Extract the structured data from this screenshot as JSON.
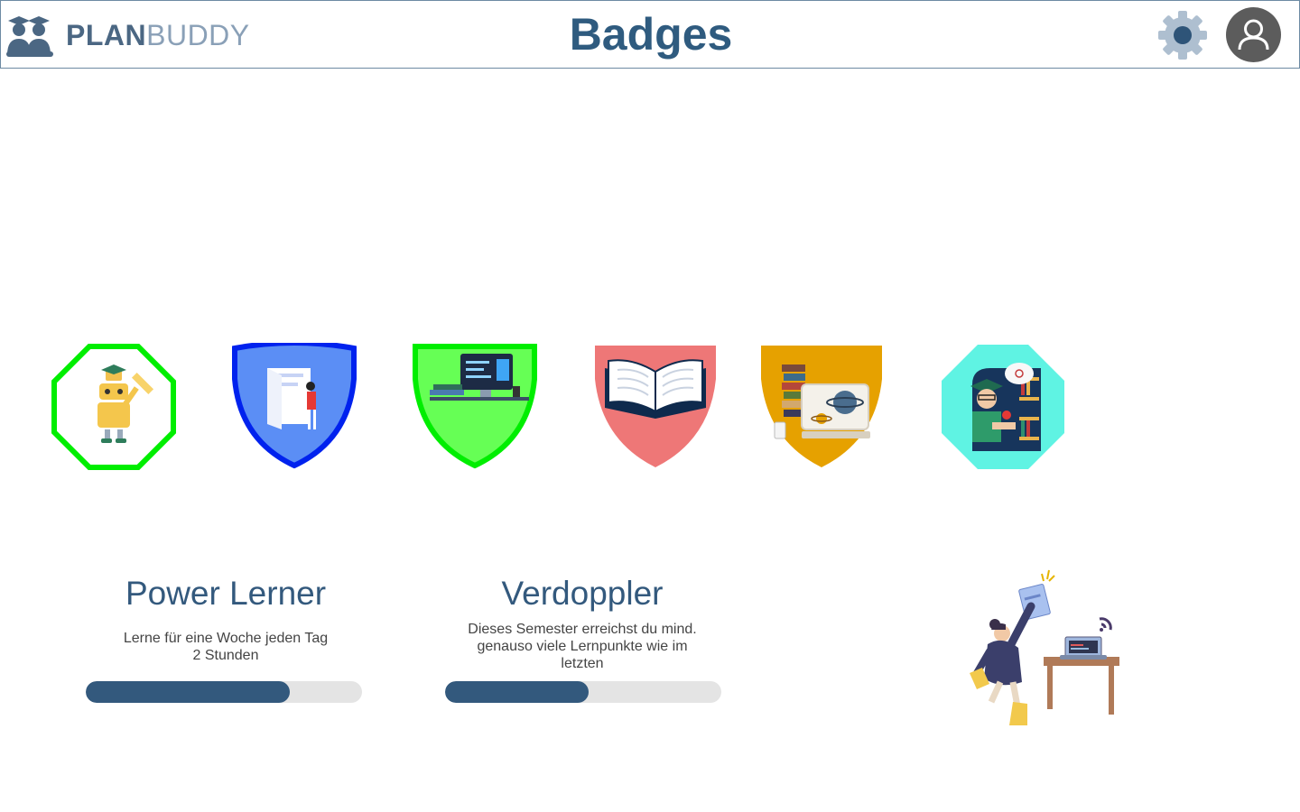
{
  "header": {
    "logo_plan": "PLAN",
    "logo_buddy": "BUDDY",
    "title": "Badges",
    "settings_icon": "gear-icon",
    "profile_icon": "user-icon"
  },
  "colors": {
    "primary": "#33597d",
    "title": "#2f5b7f",
    "bar_track": "#e4e4e4"
  },
  "badges": [
    {
      "name": "robot-badge",
      "shape": "octagon",
      "color": "#00ee00"
    },
    {
      "name": "presentation-badge",
      "shape": "shield",
      "color": "#0022ee"
    },
    {
      "name": "computer-badge",
      "shape": "shield",
      "color": "#00ee00"
    },
    {
      "name": "book-badge",
      "shape": "shield",
      "color": "#ee7777"
    },
    {
      "name": "astronomy-badge",
      "shape": "shield",
      "color": "#e6a100"
    },
    {
      "name": "science-badge",
      "shape": "octagon",
      "color": "#5ff3e3"
    }
  ],
  "achievements": [
    {
      "title": "Power Lerner",
      "desc_line1": "Lerne für eine Woche jeden Tag",
      "desc_line2": "2 Stunden",
      "desc_line3": "",
      "progress": 0.74
    },
    {
      "title": "Verdoppler",
      "desc_line1": "Dieses Semester erreichst du mind.",
      "desc_line2": "genauso viele Lernpunkte wie im",
      "desc_line3": "letzten",
      "progress": 0.52
    }
  ]
}
